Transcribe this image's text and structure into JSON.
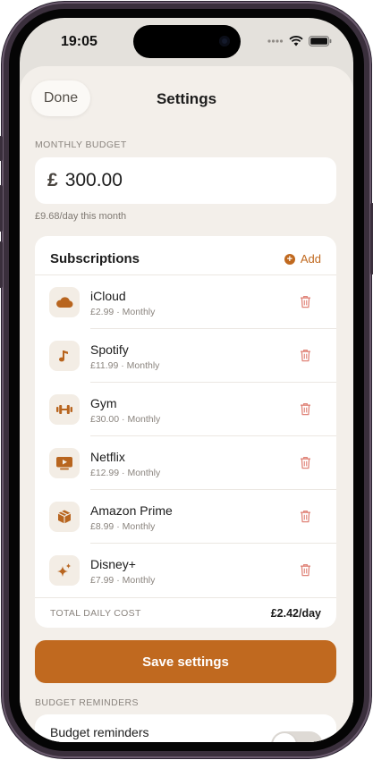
{
  "status_bar": {
    "time": "19:05"
  },
  "header": {
    "done_label": "Done",
    "title": "Settings"
  },
  "budget": {
    "section_label": "MONTHLY BUDGET",
    "currency_symbol": "£",
    "amount": "300.00",
    "per_day_hint": "£9.68/day this month"
  },
  "subscriptions": {
    "heading": "Subscriptions",
    "add_label": "Add",
    "items": [
      {
        "name": "iCloud",
        "meta": "£2.99 · Monthly",
        "icon": "cloud-icon"
      },
      {
        "name": "Spotify",
        "meta": "£11.99 · Monthly",
        "icon": "music-note-icon"
      },
      {
        "name": "Gym",
        "meta": "£30.00 · Monthly",
        "icon": "dumbbell-icon"
      },
      {
        "name": "Netflix",
        "meta": "£12.99 · Monthly",
        "icon": "play-tv-icon"
      },
      {
        "name": "Amazon Prime",
        "meta": "£8.99 · Monthly",
        "icon": "package-box-icon"
      },
      {
        "name": "Disney+",
        "meta": "£7.99 · Monthly",
        "icon": "sparkles-icon"
      }
    ],
    "total_label": "TOTAL DAILY COST",
    "total_value": "£2.42/day"
  },
  "save_label": "Save settings",
  "reminders": {
    "section_label": "BUDGET REMINDERS",
    "toggle_label": "Budget reminders",
    "enabled": false
  },
  "colors": {
    "accent": "#c0691f",
    "delete": "#e0857a",
    "sheet_background": "#f3efea",
    "icon_tile": "#f3ede5"
  }
}
